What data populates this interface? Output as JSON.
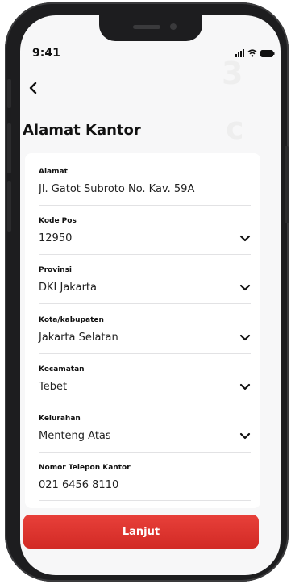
{
  "status": {
    "time": "9:41",
    "icons": [
      "signal-icon",
      "wifi-icon",
      "battery-icon"
    ]
  },
  "nav": {
    "back_icon": "chevron-left-icon"
  },
  "page": {
    "title": "Alamat Kantor"
  },
  "fields": [
    {
      "label": "Alamat",
      "value": "Jl. Gatot Subroto No. Kav. 59A",
      "dropdown": false
    },
    {
      "label": "Kode Pos",
      "value": "12950",
      "dropdown": true
    },
    {
      "label": "Provinsi",
      "value": "DKI Jakarta",
      "dropdown": true
    },
    {
      "label": "Kota/kabupaten",
      "value": "Jakarta Selatan",
      "dropdown": true
    },
    {
      "label": "Kecamatan",
      "value": "Tebet",
      "dropdown": true
    },
    {
      "label": "Kelurahan",
      "value": "Menteng Atas",
      "dropdown": true
    },
    {
      "label": "Nomor Telepon Kantor",
      "value": "021 6456 8110",
      "dropdown": false
    }
  ],
  "actions": {
    "next_label": "Lanjut"
  },
  "colors": {
    "accent": "#d9302b",
    "background": "#f7f7f8",
    "card": "#ffffff"
  }
}
